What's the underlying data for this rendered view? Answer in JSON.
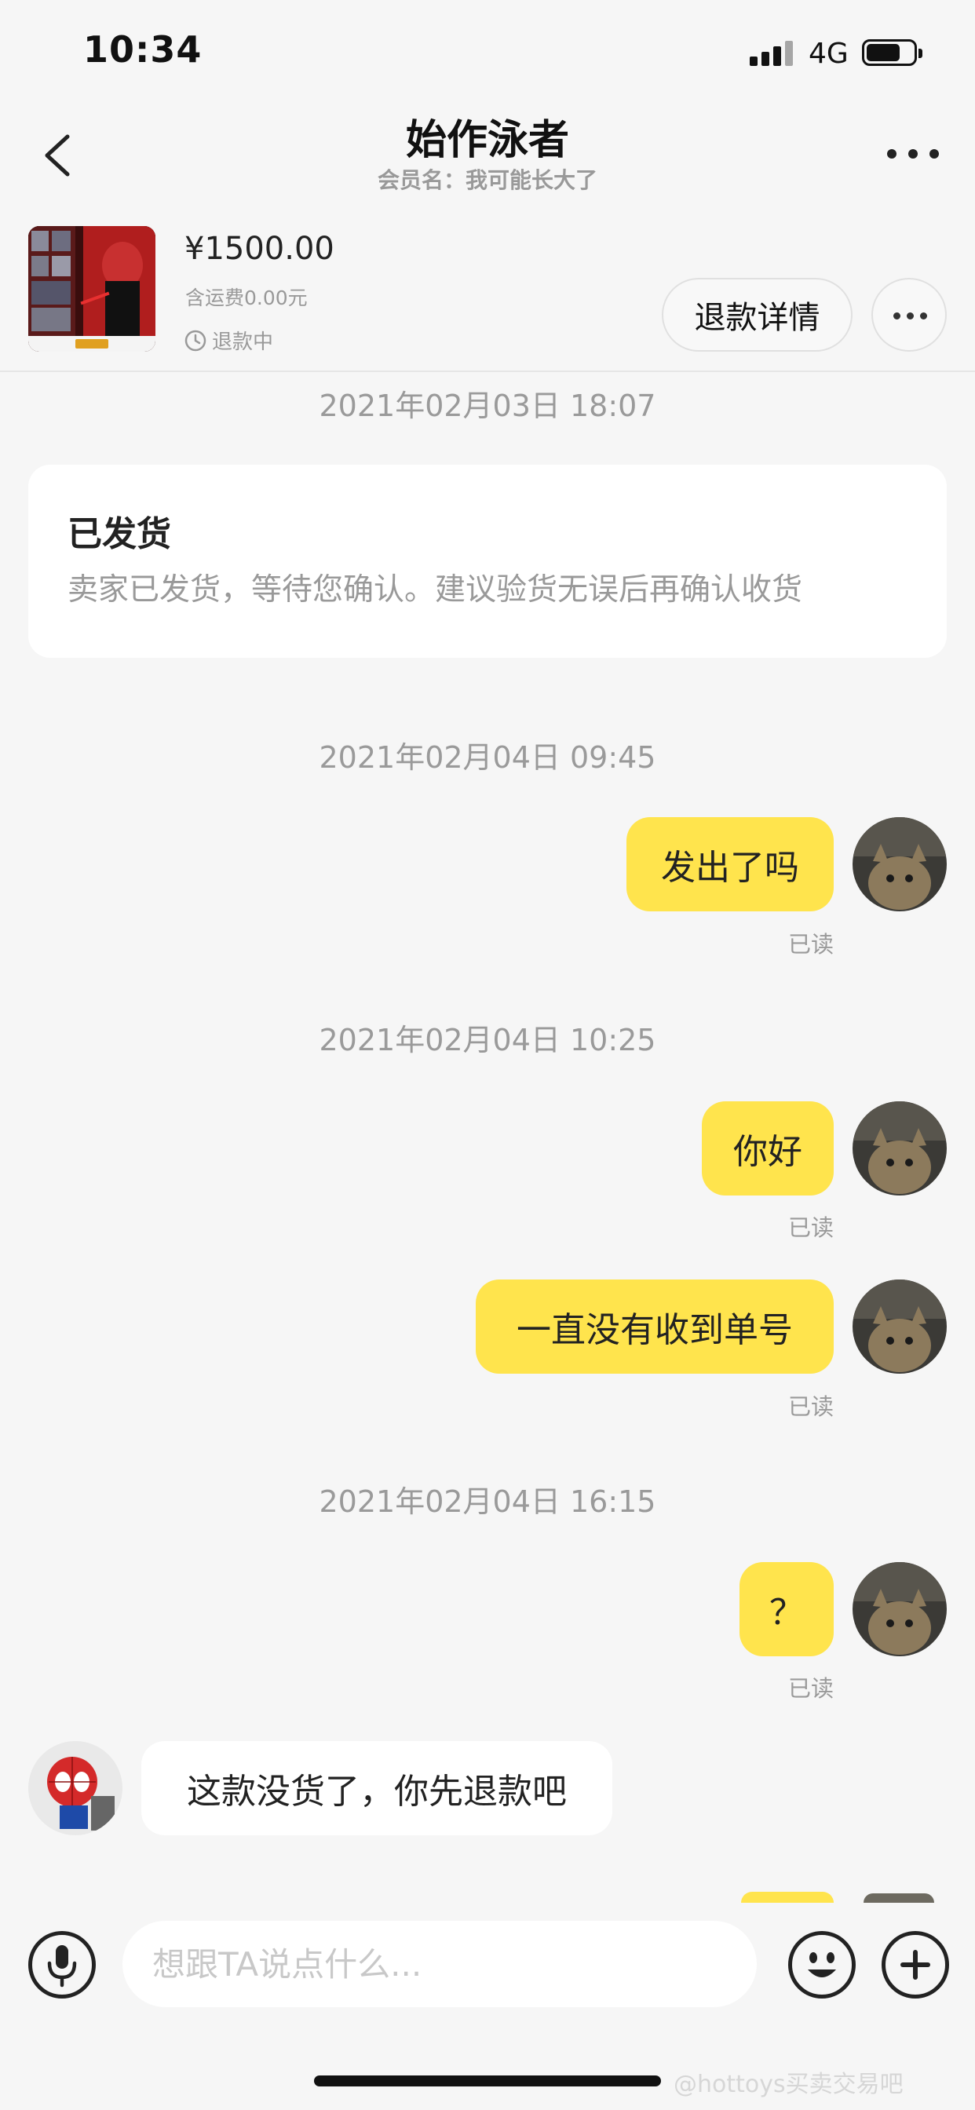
{
  "status_bar": {
    "time": "10:34",
    "network": "4G"
  },
  "header": {
    "title": "始作泳者",
    "subtitle": "会员名：我可能长大了"
  },
  "product": {
    "price": "¥1500.00",
    "shipping": "含运费0.00元",
    "status": "退款中",
    "refund_detail_label": "退款详情"
  },
  "messages": {
    "ts1": "2021年02月03日 18:07",
    "notice_title": "已发货",
    "notice_text": "卖家已发货，等待您确认。建议验货无误后再确认收货",
    "ts2": "2021年02月04日 09:45",
    "m1": "发出了吗",
    "ts3": "2021年02月04日 10:25",
    "m2": "你好",
    "m3": "一直没有收到单号",
    "ts4": "2021年02月04日 16:15",
    "m4": "？",
    "m5": "这款没货了，你先退款吧",
    "read": "已读"
  },
  "input": {
    "placeholder": "想跟TA说点什么..."
  },
  "watermark": "@hottoys买卖交易吧",
  "colors": {
    "outgoing_bubble": "#ffe44d",
    "background": "#f6f6f6"
  }
}
